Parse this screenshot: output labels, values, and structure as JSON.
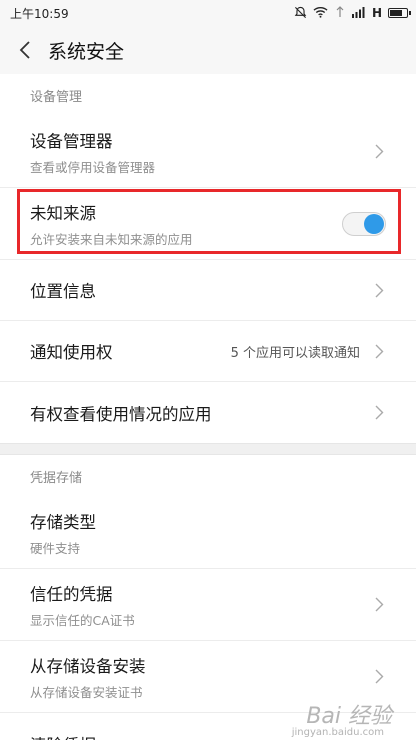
{
  "status_bar": {
    "time": "上午10:59",
    "network": "H",
    "icons": [
      "mute-bell-icon",
      "wifi-icon",
      "signal-icon",
      "signal-icon",
      "battery-icon"
    ],
    "battery_level": 0.8
  },
  "header": {
    "title": "系统安全"
  },
  "sections": {
    "device_admin": {
      "label": "设备管理",
      "items": [
        {
          "title": "设备管理器",
          "subtitle": "查看或停用设备管理器"
        },
        {
          "title": "未知来源",
          "subtitle": "允许安装来自未知来源的应用",
          "toggle_on": true
        },
        {
          "title": "位置信息"
        },
        {
          "title": "通知使用权",
          "value": "5 个应用可以读取通知"
        },
        {
          "title": "有权查看使用情况的应用"
        }
      ]
    },
    "credential_storage": {
      "label": "凭据存储",
      "items": [
        {
          "title": "存储类型",
          "subtitle": "硬件支持"
        },
        {
          "title": "信任的凭据",
          "subtitle": "显示信任的CA证书"
        },
        {
          "title": "从存储设备安装",
          "subtitle": "从存储设备安装证书"
        },
        {
          "title": "清除凭据"
        }
      ]
    }
  },
  "colors": {
    "accent": "#2f9ae8",
    "highlight": "#e8282a"
  },
  "watermark": {
    "brand": "Bai 经验",
    "url": "jingyan.baidu.com"
  }
}
